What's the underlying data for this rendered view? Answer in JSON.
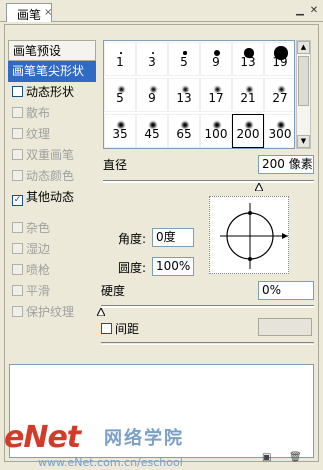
{
  "window": {
    "tab_label": "画笔",
    "close_glyph": "×"
  },
  "sidebar": {
    "items": [
      {
        "label": "画笔预设",
        "kind": "header"
      },
      {
        "label": "画笔笔尖形状",
        "kind": "selected"
      },
      {
        "label": "动态形状",
        "kind": "check",
        "checked": false,
        "disabled": false
      },
      {
        "label": "散布",
        "kind": "check",
        "checked": false,
        "disabled": true
      },
      {
        "label": "纹理",
        "kind": "check",
        "checked": false,
        "disabled": true
      },
      {
        "label": "双重画笔",
        "kind": "check",
        "checked": false,
        "disabled": true
      },
      {
        "label": "动态颜色",
        "kind": "check",
        "checked": false,
        "disabled": true
      },
      {
        "label": "其他动态",
        "kind": "check",
        "checked": true,
        "disabled": false
      },
      {
        "label": "",
        "kind": "gap"
      },
      {
        "label": "杂色",
        "kind": "check",
        "checked": false,
        "disabled": true
      },
      {
        "label": "湿边",
        "kind": "check",
        "checked": false,
        "disabled": true
      },
      {
        "label": "喷枪",
        "kind": "check",
        "checked": false,
        "disabled": true
      },
      {
        "label": "平滑",
        "kind": "check",
        "checked": false,
        "disabled": true
      },
      {
        "label": "保护纹理",
        "kind": "check",
        "checked": false,
        "disabled": true
      }
    ]
  },
  "brushes": {
    "rows": [
      [
        "1",
        "3",
        "5",
        "9",
        "13",
        "19"
      ],
      [
        "5",
        "9",
        "13",
        "17",
        "21",
        "27"
      ],
      [
        "35",
        "45",
        "65",
        "100",
        "200",
        "300"
      ]
    ],
    "selected": "200"
  },
  "diameter": {
    "label": "直径",
    "value": "200 像素",
    "slider_fraction": 0.74
  },
  "angle": {
    "label": "角度:",
    "value": "0度"
  },
  "roundness": {
    "label": "圆度:",
    "value": "100%"
  },
  "hardness": {
    "label": "硬度",
    "value": "0%",
    "slider_fraction": 0.0
  },
  "spacing": {
    "label": "间距",
    "checked": false,
    "value": ""
  },
  "watermark": {
    "logo": "eNet",
    "cn": "网络学院",
    "url": "www.eNet.com.cn/eschool"
  },
  "colors": {
    "selection": "#316ac5",
    "panel": "#ece9d8",
    "watermark_red": "#d23b2a",
    "watermark_blue": "#7aa0c8"
  }
}
